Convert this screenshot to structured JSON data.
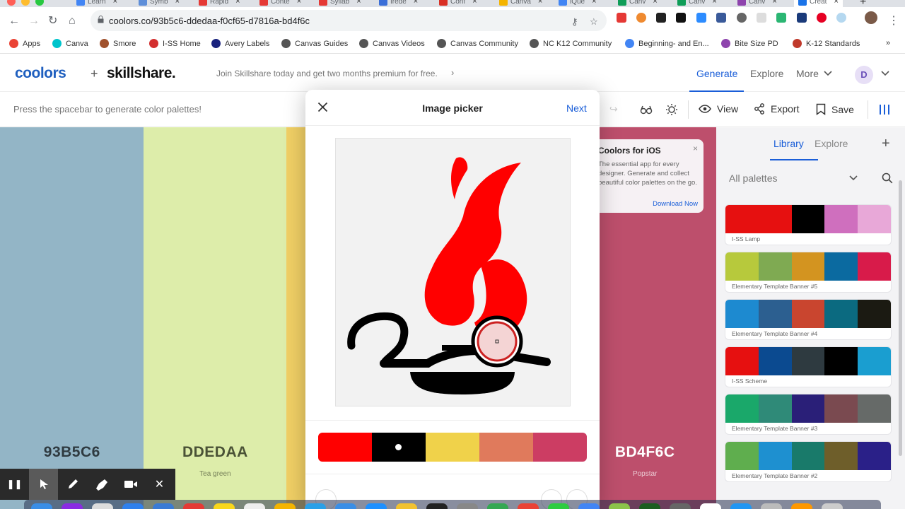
{
  "browser": {
    "tabs": [
      {
        "label": "Learn",
        "color": "#4285f4"
      },
      {
        "label": "Symb",
        "color": "#5f8fd9"
      },
      {
        "label": "Rapid",
        "color": "#e53935"
      },
      {
        "label": "Conte",
        "color": "#e53935"
      },
      {
        "label": "Syllab",
        "color": "#e53935"
      },
      {
        "label": "Irede",
        "color": "#3b6fd8"
      },
      {
        "label": "Conf",
        "color": "#d93025"
      },
      {
        "label": "Canva",
        "color": "#f4b400"
      },
      {
        "label": "iQue",
        "color": "#4285f4"
      },
      {
        "label": "Canv",
        "color": "#0f9d58"
      },
      {
        "label": "Canv",
        "color": "#0f9d58"
      },
      {
        "label": "Canv",
        "color": "#8e44ad"
      },
      {
        "label": "Creat",
        "color": "#1a73e8"
      }
    ],
    "url": "coolors.co/93b5c6-ddedaa-f0cf65-d7816a-bd4f6c",
    "bookmarks": [
      {
        "label": "Apps",
        "color": "#ea4335"
      },
      {
        "label": "Canva",
        "color": "#00c4cc"
      },
      {
        "label": "Smore",
        "color": "#a0522d"
      },
      {
        "label": "I-SS Home",
        "color": "#d32f2f"
      },
      {
        "label": "Avery Labels",
        "color": "#1a237e"
      },
      {
        "label": "Canvas Guides",
        "color": "#555555"
      },
      {
        "label": "Canvas Videos",
        "color": "#555555"
      },
      {
        "label": "Canvas Community",
        "color": "#555555"
      },
      {
        "label": "NC K12 Community",
        "color": "#555555"
      },
      {
        "label": "Beginning- and En...",
        "color": "#4285f4"
      },
      {
        "label": "Bite Size PD",
        "color": "#8e44ad"
      },
      {
        "label": "K-12 Standards",
        "color": "#c0392b"
      }
    ],
    "bookmarks_more": "»"
  },
  "header": {
    "logo_coolors": "coolors",
    "plus": "+",
    "logo_skillshare": "skillshare.",
    "promo": "Join Skillshare today and get two months premium for free.",
    "promo_chevron": "›",
    "nav": {
      "generate": "Generate",
      "explore": "Explore",
      "more": "More"
    },
    "avatar_letter": "D"
  },
  "toolbar": {
    "hint": "Press the spacebar to generate color palettes!",
    "view": "View",
    "export": "Export",
    "save": "Save"
  },
  "palette": [
    {
      "hex": "93B5C6",
      "name": "",
      "color": "#93b5c6",
      "text": "#2f3a40"
    },
    {
      "hex": "DDEDAA",
      "name": "Tea green",
      "color": "#ddedaa",
      "text": "#4a5236"
    },
    {
      "hex": "",
      "name": "",
      "color": "#f0cf65",
      "text": "#5a4a1a"
    },
    {
      "hex": "",
      "name": "",
      "color": "#d7816a",
      "text": "#5a2a1e"
    },
    {
      "hex": "BD4F6C",
      "name": "Popstar",
      "color": "#bd4f6c",
      "text": "#ffffff"
    }
  ],
  "ios_promo": {
    "title": "Coolors for iOS",
    "text": "The essential app for every designer. Generate and collect beautiful color palettes on the go.",
    "link": "Download Now",
    "close": "×"
  },
  "sidebar": {
    "tab_library": "Library",
    "tab_explore": "Explore",
    "plus": "+",
    "dropdown": "All palettes",
    "palettes": [
      {
        "name": "I-SS Lamp",
        "colors": [
          "#e61010",
          "#e61010",
          "#000000",
          "#cf6fbe",
          "#e8a8d8"
        ]
      },
      {
        "name": "Elementary Template Banner #5",
        "colors": [
          "#b7c93c",
          "#7faa52",
          "#d39420",
          "#0b6aa0",
          "#d81b4a"
        ]
      },
      {
        "name": "Elementary Template Banner #4",
        "colors": [
          "#1d8ad0",
          "#2c5f90",
          "#c9452f",
          "#0b6a80",
          "#1b1a12"
        ]
      },
      {
        "name": "I-SS Scheme",
        "colors": [
          "#e61010",
          "#0b4a90",
          "#2e3a40",
          "#000000",
          "#1a9ed0"
        ]
      },
      {
        "name": "Elementary Template Banner #3",
        "colors": [
          "#1aa86a",
          "#2f8a78",
          "#2a1f78",
          "#7a4a50",
          "#666a68"
        ]
      },
      {
        "name": "Elementary Template Banner #2",
        "colors": [
          "#5fae4e",
          "#1e90d0",
          "#197a6a",
          "#6e5e2a",
          "#2a2088"
        ]
      }
    ]
  },
  "modal": {
    "title": "Image picker",
    "next": "Next",
    "colors": [
      "#ff0000",
      "#000000",
      "#f0d24a",
      "#e07a5c",
      "#cc3d63"
    ],
    "selected_index": 1
  },
  "recorder": {
    "pause": "❚❚",
    "close": "✕"
  }
}
